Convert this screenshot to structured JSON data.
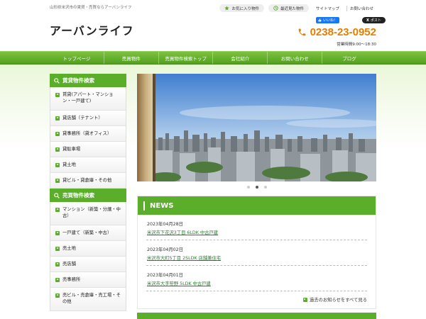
{
  "header": {
    "tagline": "山形県米沢市の賃貸・売買ならアーバンライフ",
    "links": {
      "favorites": "お気に入り物件",
      "recent": "最近見た物件",
      "sitemap": "サイトマップ",
      "contact": "お問い合わせ"
    },
    "logo": "アーバンライフ",
    "social": {
      "facebook": "いいね！",
      "twitter": "ポスト"
    },
    "phone": "0238-23-0952",
    "hours": "営業時間9:00～18:30"
  },
  "nav": {
    "items": [
      "トップページ",
      "売買物件",
      "売買物件検索トップ",
      "会社紹介",
      "お問い合わせ",
      "ブログ"
    ]
  },
  "sidebar": {
    "rental_title": "賃貸物件検索",
    "rental_items": [
      "賃貸(アパート・マンション・一戸建て)",
      "貸店舗（テナント）",
      "貸事務所（貸オフィス）",
      "貸駐車場",
      "貸土地",
      "貸ビル・貸倉庫・その他"
    ],
    "sale_title": "売買物件検索",
    "sale_items": [
      "マンション（新築・分譲・中古）",
      "一戸建て（新築・中古）",
      "売土地",
      "売店舗",
      "売事務所",
      "売ビル・売倉庫・売工場・その他"
    ]
  },
  "news": {
    "title": "NEWS",
    "items": [
      {
        "date": "2023年04月28日",
        "text": "米沢市下花沢3丁目 6LDK 中古戸建"
      },
      {
        "date": "2023年04月02日",
        "text": "米沢市大町5丁目 2SLDK 店舗兼住宅"
      },
      {
        "date": "2023年04月01日",
        "text": "米沢市大字笹野 5LDK 中古戸建"
      }
    ],
    "more": "過去のお知らせをすべて見る"
  },
  "slider": {
    "active_index": 1,
    "count": 3
  },
  "colors": {
    "accent": "#5aae2a",
    "phone": "#e67e00",
    "link": "#2e7d32"
  }
}
